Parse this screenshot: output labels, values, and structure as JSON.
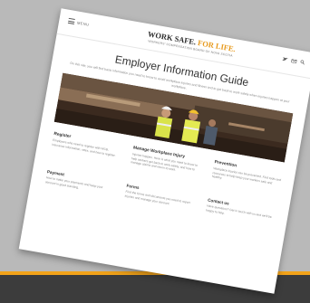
{
  "header": {
    "menu_label": "MENU",
    "logo_part1": "WORK SAFE.",
    "logo_part2": "FOR LIFE.",
    "tagline": "WORKERS' COMPENSATION BOARD OF NOVA SCOTIA"
  },
  "page": {
    "title": "Employer Information Guide",
    "intro": "On this site, you will find basic information you need to know to avoid workplace injuries and illness and to get back to work safely when injuries happen at your workplace."
  },
  "sections": {
    "register": {
      "title": "Register",
      "text": "Employers who need to register with WCB, insurance information, rates, and how to register."
    },
    "manage": {
      "title": "Manage Workplace Injury",
      "text": "Injuries happen. Here is what you need to know to help workers get back to work safely, and how to manage claims and return to work."
    },
    "prevention": {
      "title": "Prevention",
      "text": "Workplace injuries can be prevented. Find tools and resources to help keep your workers safe and healthy."
    },
    "payment": {
      "title": "Payment",
      "text": "How to make your payments and keep your account in good standing."
    },
    "forms": {
      "title": "Forms",
      "text": "Find the forms and documents you need to report injuries and manage your account."
    },
    "contact": {
      "title": "Contact us",
      "text": "Have questions? Get in touch with us and we'll be happy to help."
    }
  },
  "colors": {
    "accent": "#e79a1d",
    "bottom_band": "#3c3c3c",
    "background": "#b9b9b9"
  },
  "icons": [
    "twitter-icon",
    "email-icon",
    "search-icon",
    "menu-icon"
  ]
}
